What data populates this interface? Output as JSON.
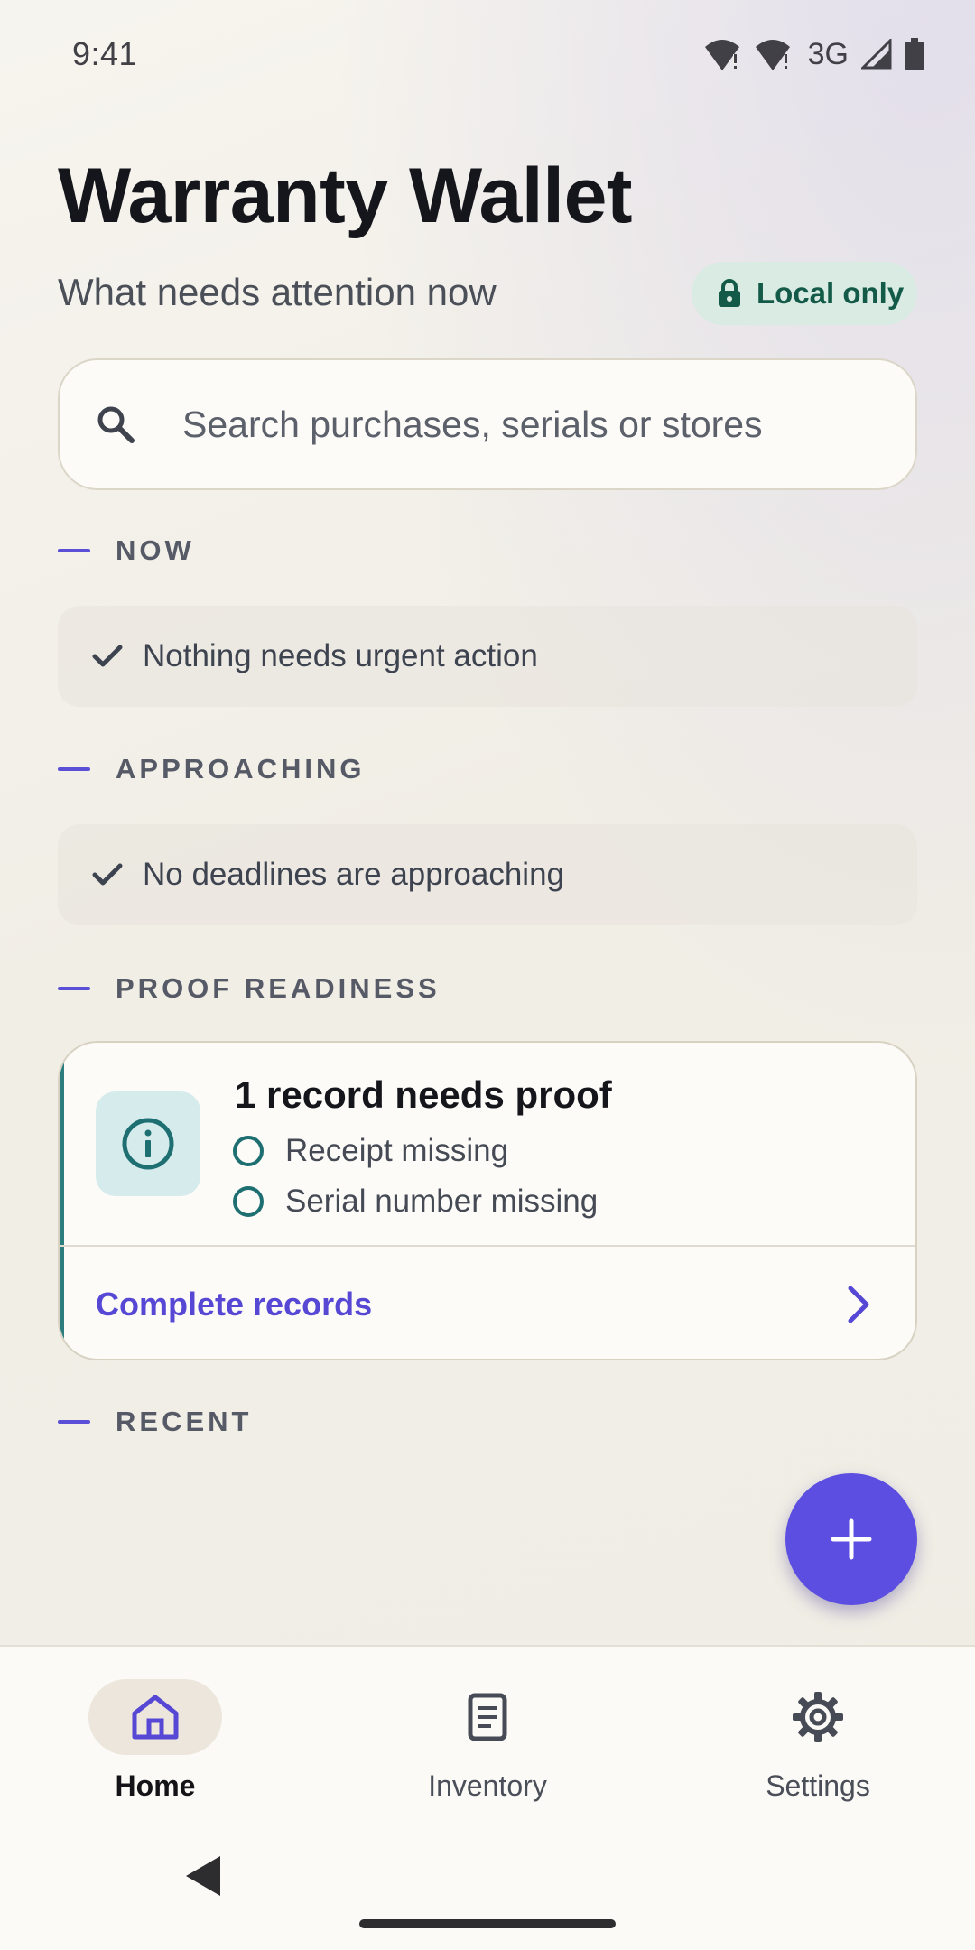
{
  "status_bar": {
    "time": "9:41",
    "network": "3G",
    "icons": [
      "wifi-alert-icon",
      "wifi-alert-icon",
      "signal-icon",
      "battery-icon"
    ]
  },
  "header": {
    "title": "Warranty Wallet",
    "subtitle": "What needs attention now",
    "badge": "Local only"
  },
  "search": {
    "placeholder": "Search purchases, serials or stores"
  },
  "sections": {
    "now": {
      "heading": "NOW",
      "message": "Nothing needs urgent action"
    },
    "approaching": {
      "heading": "APPROACHING",
      "message": "No deadlines are approaching"
    },
    "proof": {
      "heading": "PROOF READINESS",
      "title": "1 record needs proof",
      "items": [
        "Receipt missing",
        "Serial number missing"
      ],
      "action": "Complete records"
    },
    "recent": {
      "heading": "RECENT"
    }
  },
  "bottom_nav": {
    "items": [
      {
        "label": "Home",
        "icon": "home-icon",
        "active": true
      },
      {
        "label": "Inventory",
        "icon": "document-icon",
        "active": false
      },
      {
        "label": "Settings",
        "icon": "gear-icon",
        "active": false
      }
    ]
  },
  "colors": {
    "accent": "#5b4ee0",
    "teal": "#1e6f72",
    "badge_bg": "#d9ebe3",
    "badge_text": "#145a48"
  }
}
